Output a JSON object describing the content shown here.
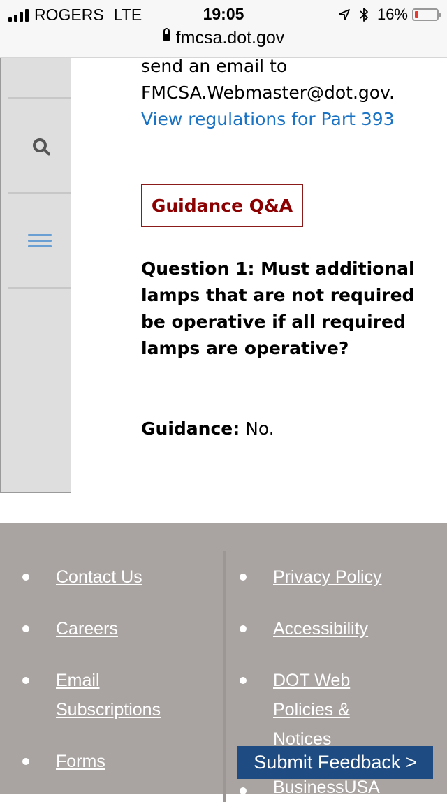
{
  "status_bar": {
    "carrier": "ROGERS",
    "network": "LTE",
    "time": "19:05",
    "battery_percent": "16%",
    "battery_level": 0.16,
    "battery_color": "#e53a2f",
    "url": "fmcsa.dot.gov",
    "icons": [
      "signal-icon",
      "location-arrow-icon",
      "bluetooth-icon",
      "battery-icon",
      "lock-icon"
    ]
  },
  "side_panel": {
    "icons": [
      "search-icon",
      "menu-icon"
    ]
  },
  "content": {
    "intro_line1": "send an email to",
    "intro_line2": "FMCSA.Webmaster@dot.gov.",
    "regulations_link": "View regulations for Part 393",
    "guidance_header": "Guidance Q&A",
    "question": "Question 1: Must additional lamps that are not required be operative if all required lamps are operative?",
    "guidance_label": "Guidance:",
    "guidance_answer": " No."
  },
  "footer": {
    "left_links": [
      {
        "label": "Contact Us"
      },
      {
        "label": "Careers"
      },
      {
        "label": "Email Subscriptions"
      },
      {
        "label": "Forms"
      }
    ],
    "right_links": [
      {
        "label": "Privacy Policy"
      },
      {
        "label": "Accessibility"
      },
      {
        "label": "DOT Web Policies & Notices"
      },
      {
        "label": "BusinessUSA"
      }
    ]
  },
  "feedback_button": "Submit Feedback >",
  "colors": {
    "link_blue": "#1a73c4",
    "guidance_red": "#8b0000",
    "footer_bg": "#a9a4a1",
    "feedback_bg": "#1e4b82"
  }
}
